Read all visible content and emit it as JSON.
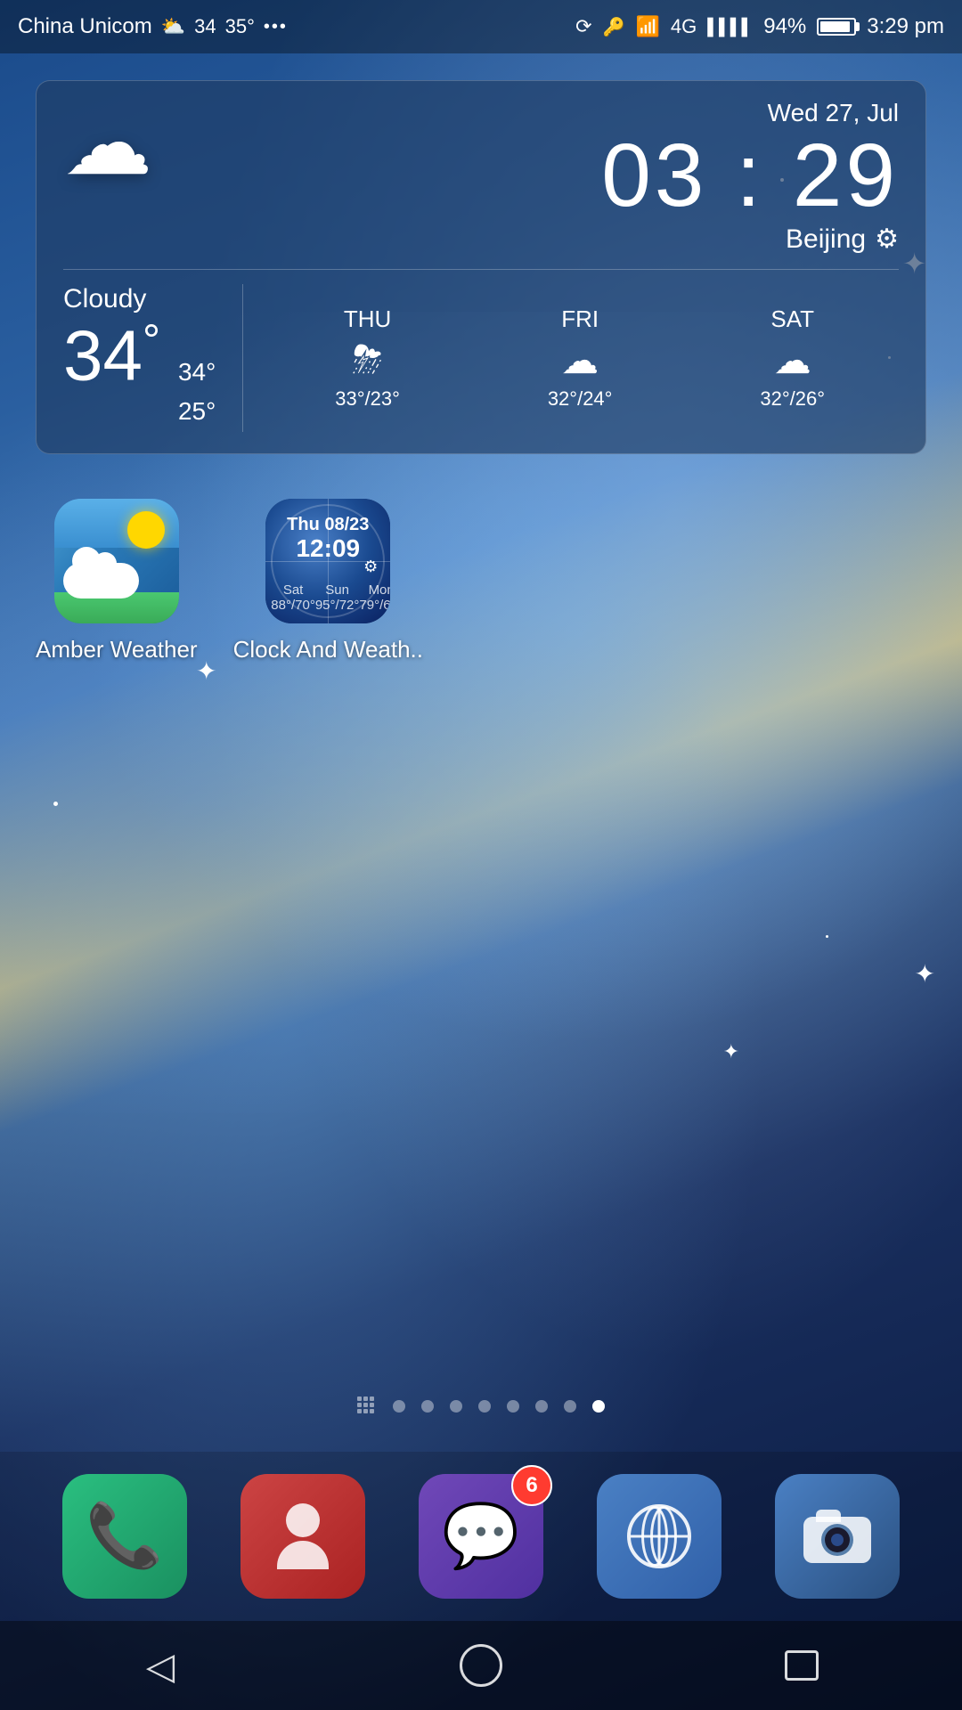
{
  "statusBar": {
    "carrier": "China Unicom",
    "weather_status": "☁",
    "temp_current": "34",
    "temp_next": "35°",
    "dots": "•••",
    "battery_pct": "94%",
    "time": "3:29 pm",
    "signal_4g": "4G"
  },
  "weatherWidget": {
    "date": "Wed 27, Jul",
    "time": "03 : 29",
    "location": "Beijing",
    "current_condition": "Cloudy",
    "current_temp": "34",
    "high_temp": "34°",
    "low_temp": "25°",
    "forecast": [
      {
        "day": "THU",
        "icon": "⛈",
        "temps": "33°/23°"
      },
      {
        "day": "FRI",
        "icon": "☁",
        "temps": "32°/24°"
      },
      {
        "day": "SAT",
        "icon": "☁",
        "temps": "32°/26°"
      }
    ]
  },
  "apps": [
    {
      "id": "amber-weather",
      "label": "Amber Weather",
      "type": "amber"
    },
    {
      "id": "clock-weather",
      "label": "Clock And Weath..",
      "type": "clock"
    }
  ],
  "pageDots": {
    "total": 8,
    "active_index": 7
  },
  "dock": [
    {
      "id": "phone",
      "type": "phone",
      "label": "Phone"
    },
    {
      "id": "contacts",
      "type": "contacts",
      "label": "Contacts"
    },
    {
      "id": "messages",
      "type": "messages",
      "label": "Messages",
      "badge": "6"
    },
    {
      "id": "browser",
      "type": "browser",
      "label": "Browser"
    },
    {
      "id": "camera",
      "type": "camera",
      "label": "Camera"
    }
  ],
  "navBar": {
    "back": "◁",
    "home": "",
    "recent": ""
  }
}
